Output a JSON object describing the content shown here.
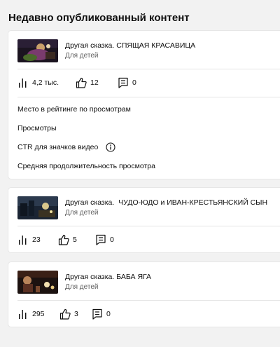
{
  "section": {
    "title": "Недавно опубликованный контент"
  },
  "videos": [
    {
      "title": "Другая сказка. СПЯЩАЯ КРАСАВИЦА",
      "audience": "Для детей",
      "views": "4,2 тыс.",
      "likes": "12",
      "comments": "0",
      "metrics": [
        "Место в рейтинге по просмотрам",
        "Просмотры",
        "CTR для значков видео",
        "Средняя продолжительность просмотра"
      ]
    },
    {
      "title": "Другая сказка.  ЧУДО-ЮДО и ИВАН-КРЕСТЬЯНСКИЙ СЫН",
      "audience": "Для детей",
      "views": "23",
      "likes": "5",
      "comments": "0"
    },
    {
      "title": "Другая сказка. БАБА ЯГА",
      "audience": "Для детей",
      "views": "295",
      "likes": "3",
      "comments": "0"
    }
  ],
  "icons": {
    "views": "bar-chart-icon",
    "likes": "thumb-up-icon",
    "comments": "comment-icon",
    "info": "info-icon"
  },
  "colors": {
    "background": "#f2f2f2",
    "card": "#ffffff",
    "secondary_text": "#606060"
  }
}
